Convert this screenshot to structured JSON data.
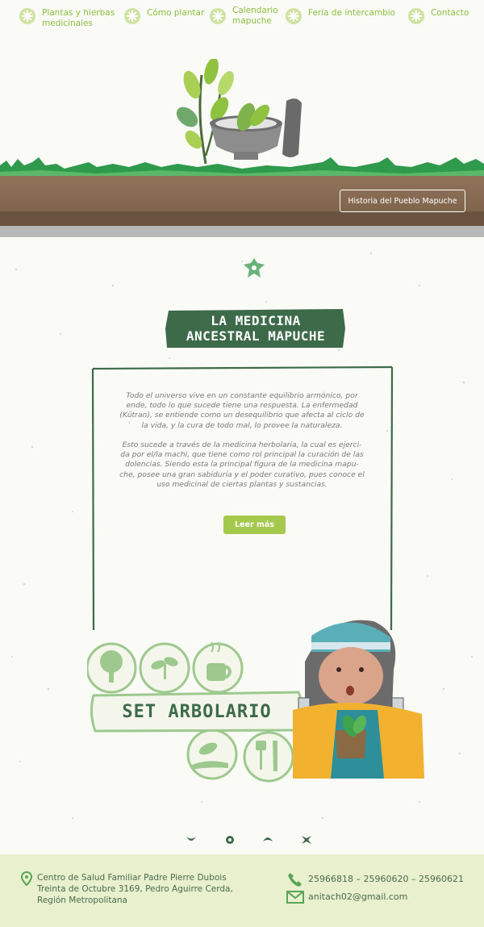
{
  "nav": {
    "items": [
      {
        "label_line1": "Plantas y hierbas",
        "label_line2": "medicinales"
      },
      {
        "label_line1": "Cómo plantar",
        "label_line2": ""
      },
      {
        "label_line1": "Calendario",
        "label_line2": "mapuche"
      },
      {
        "label_line1": "Feria de intercambio",
        "label_line2": ""
      },
      {
        "label_line1": "Contacto",
        "label_line2": ""
      }
    ],
    "icon": "flower-icon"
  },
  "hero": {
    "history_button": "Historia del Pueblo Mapuche"
  },
  "main": {
    "title_line1": "LA MEDICINA",
    "title_line2": "ANCESTRAL MAPUCHE",
    "paragraph1": [
      "Todo el universo vive en un constante equilibrio armónico, por",
      "ende, todo lo que sucede tiene una respuesta. La enfermedad",
      "(Kütran), se entiende como un desequilibrio que afecta al ciclo de",
      "la vida, y la cura de todo mal, lo provee la naturaleza."
    ],
    "paragraph2": [
      "Esto sucede a través de la medicina herbolaria, la cual es ejerci-",
      "da por el/la machi, que tiene como rol principal la curación de las",
      "dolencias. Siendo esta la principal figura de la medicina mapu-",
      "che, posee una gran sabiduría y el poder curativo, pues conoce el",
      "uso medicinal de ciertas plantas y sustancias."
    ],
    "read_more": "Leer más",
    "set_label": "SET ARBOLARIO"
  },
  "footer": {
    "address_line1": "Centro de Salud Familiar Padre Pierre Dubois",
    "address_line2": "Treinta de Octubre 3169, Pedro Aguirre Cerda,",
    "address_line3": "Región Metropolitana",
    "phones": "25966818 – 25960620 – 25960621",
    "email": "anitach02@gmail.com"
  },
  "colors": {
    "accent_green": "#8cbf3f",
    "button_green": "#a4c94c",
    "banner_dark": "#3d6b4a",
    "footer_bg": "#e9f0cd"
  }
}
